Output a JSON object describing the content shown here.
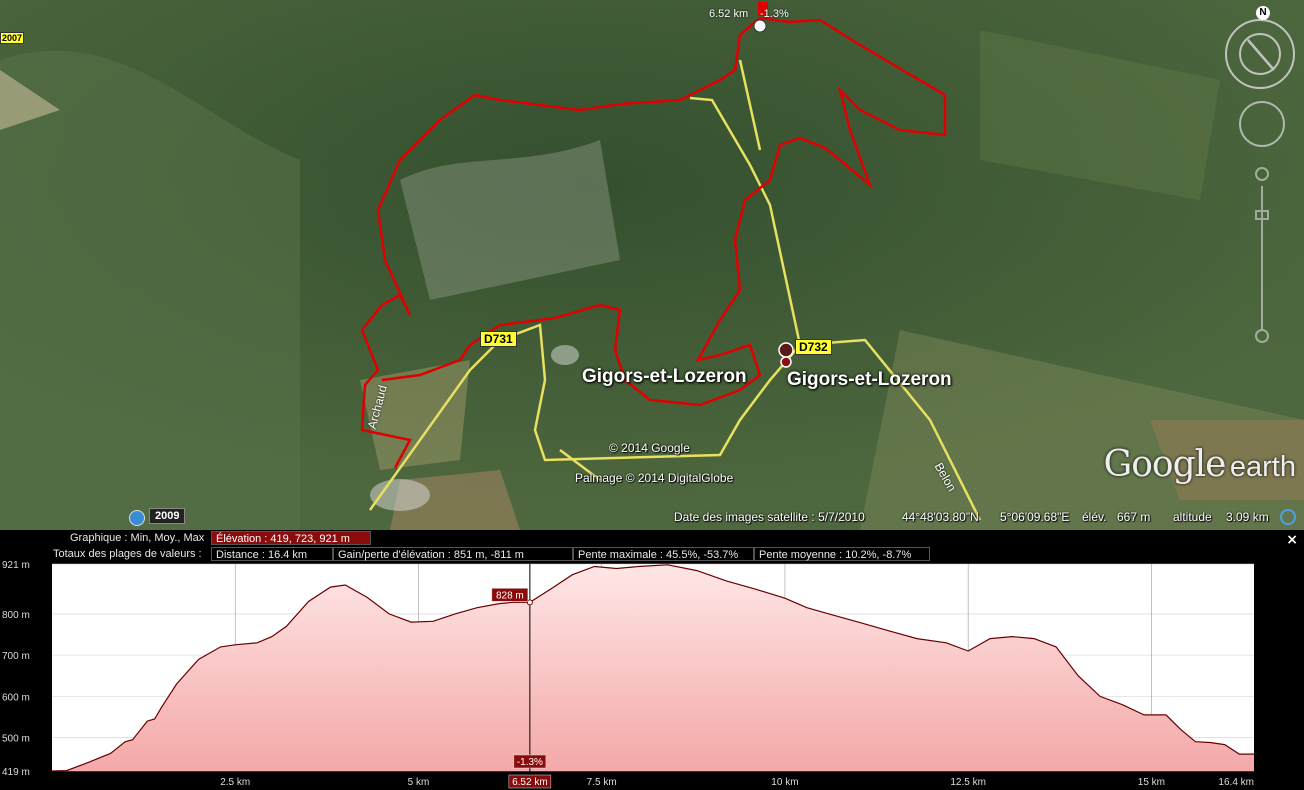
{
  "map": {
    "place_labels": [
      "Gigors-et-Lozeron",
      "Gigors-et-Lozeron"
    ],
    "roads": [
      "D731",
      "D732"
    ],
    "streets": [
      "Archaud",
      "Belon"
    ],
    "copyrights": [
      "© 2014 Google",
      "Palmage © 2014 DigitalGlobe"
    ],
    "top_marker": {
      "distance": "6.52 km",
      "slope": "-1.3%"
    },
    "left_badge": "2007",
    "logo": {
      "brand": "Google",
      "product": "earth"
    },
    "compass_north": "N"
  },
  "statusbar": {
    "year": "2009",
    "image_date": "Date des images satellite : 5/7/2010",
    "lat": "44°48'03.80\"N",
    "lon": "5°06'09.68\"E",
    "elev_label": "élév.",
    "elev_value": "667 m",
    "alt_label": "altitude",
    "alt_value": "3.09 km"
  },
  "profile": {
    "graph_label": "Graphique : Min, Moy., Max",
    "elevation_stat": "Élévation : 419, 723, 921 m",
    "totals_label": "Totaux des plages de valeurs :",
    "distance": "Distance : 16.4 km",
    "gain_loss": "Gain/perte d'élévation : 851 m, -811 m",
    "max_slope": "Pente maximale : 45.5%, -53.7%",
    "avg_slope": "Pente moyenne : 10.2%, -8.7%",
    "close_label": "×",
    "cursor": {
      "elevation": "828 m",
      "slope": "-1.3%",
      "distance": "6.52 km",
      "distance_value": 6.52,
      "elevation_value": 828
    }
  },
  "chart_data": {
    "type": "area",
    "title": "",
    "xlabel": "",
    "ylabel": "",
    "xlim": [
      0,
      16.4
    ],
    "ylim": [
      419,
      921
    ],
    "y_ticks": [
      {
        "value": 921,
        "label": "921 m"
      },
      {
        "value": 800,
        "label": "800 m"
      },
      {
        "value": 700,
        "label": "700 m"
      },
      {
        "value": 600,
        "label": "600 m"
      },
      {
        "value": 500,
        "label": "500 m"
      },
      {
        "value": 419,
        "label": "419 m"
      }
    ],
    "x_ticks": [
      {
        "value": 2.5,
        "label": "2.5 km"
      },
      {
        "value": 5,
        "label": "5 km"
      },
      {
        "value": 7.5,
        "label": "7.5 km"
      },
      {
        "value": 10,
        "label": "10 km"
      },
      {
        "value": 12.5,
        "label": "12.5 km"
      },
      {
        "value": 15,
        "label": "15 km"
      },
      {
        "value": 16.4,
        "label": "16.4 km"
      }
    ],
    "x": [
      0,
      0.2,
      0.5,
      0.8,
      1.0,
      1.1,
      1.3,
      1.4,
      1.5,
      1.7,
      2.0,
      2.3,
      2.5,
      2.8,
      3.0,
      3.2,
      3.5,
      3.8,
      4.0,
      4.3,
      4.6,
      4.9,
      5.2,
      5.5,
      5.8,
      6.1,
      6.3,
      6.52,
      6.8,
      7.1,
      7.4,
      7.7,
      8.0,
      8.4,
      8.8,
      9.2,
      9.6,
      10.0,
      10.3,
      10.6,
      11.0,
      11.4,
      11.8,
      12.2,
      12.5,
      12.8,
      13.1,
      13.4,
      13.7,
      14.0,
      14.3,
      14.6,
      14.9,
      15.2,
      15.4,
      15.6,
      15.8,
      16.0,
      16.2,
      16.4
    ],
    "y": [
      419,
      420,
      440,
      462,
      490,
      495,
      540,
      545,
      575,
      630,
      690,
      720,
      725,
      730,
      745,
      770,
      830,
      865,
      870,
      840,
      800,
      780,
      782,
      800,
      815,
      825,
      828,
      828,
      860,
      895,
      915,
      910,
      915,
      919,
      905,
      880,
      860,
      838,
      815,
      800,
      780,
      760,
      740,
      730,
      710,
      740,
      745,
      740,
      720,
      650,
      600,
      580,
      555,
      555,
      520,
      490,
      488,
      483,
      460,
      460
    ],
    "grid": true,
    "colors": {
      "line": "#6a0000",
      "fill_top": "#ffe6e6",
      "fill_bottom": "#f4a8a8",
      "cursor_box": "#8a0b0b"
    }
  },
  "colors": {
    "track": "#e00000",
    "road": "#e8e060",
    "stat_highlight": "#8a0b0b"
  }
}
